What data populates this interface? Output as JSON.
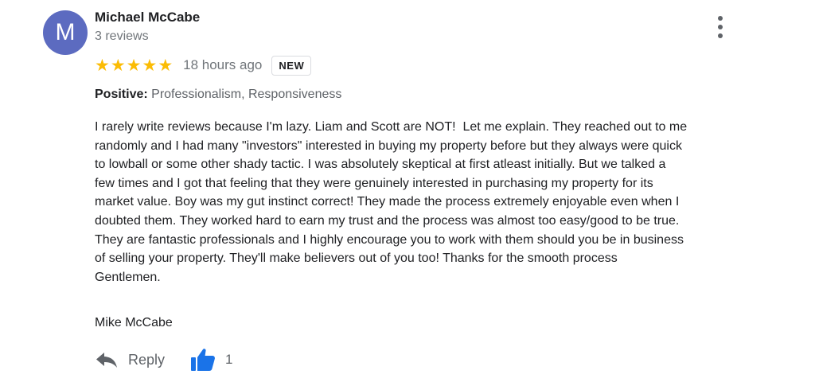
{
  "review": {
    "avatar_initial": "M",
    "author_name": "Michael McCabe",
    "review_count": "3 reviews",
    "rating": 5,
    "rating_max": 5,
    "stars": [
      "★",
      "★",
      "★",
      "★",
      "★"
    ],
    "time_ago": "18 hours ago",
    "badge": "NEW",
    "attribute_label": "Positive:",
    "attribute_value": "Professionalism, Responsiveness",
    "body": "I rarely write reviews because I'm lazy. Liam and Scott are NOT!  Let me explain. They reached out to me\nrandomly and I had many \"investors\" interested in buying my property before but they always were quick\nto lowball or some other shady tactic. I was absolutely skeptical at first atleast initially. But we talked a\nfew times and I got that feeling that they were genuinely interested in purchasing my property for its\nmarket value. Boy was my gut instinct correct! They made the process extremely enjoyable even when I\ndoubted them. They worked hard to earn my trust and the process was almost too easy/good to be true.\nThey are fantastic professionals and I highly encourage you to work with them should you be in business\nof selling your property. They'll make believers out of you too! Thanks for the smooth process\nGentlemen.",
    "signature": "Mike McCabe"
  },
  "actions": {
    "reply_label": "Reply",
    "like_count": "1"
  },
  "icons": {
    "more": "more-vert-icon",
    "reply": "reply-arrow-icon",
    "like": "thumbs-up-icon"
  },
  "colors": {
    "avatar_bg": "#5c6bc0",
    "star": "#fbbc04",
    "like_icon": "#1a73e8",
    "secondary_text": "#70757a"
  }
}
